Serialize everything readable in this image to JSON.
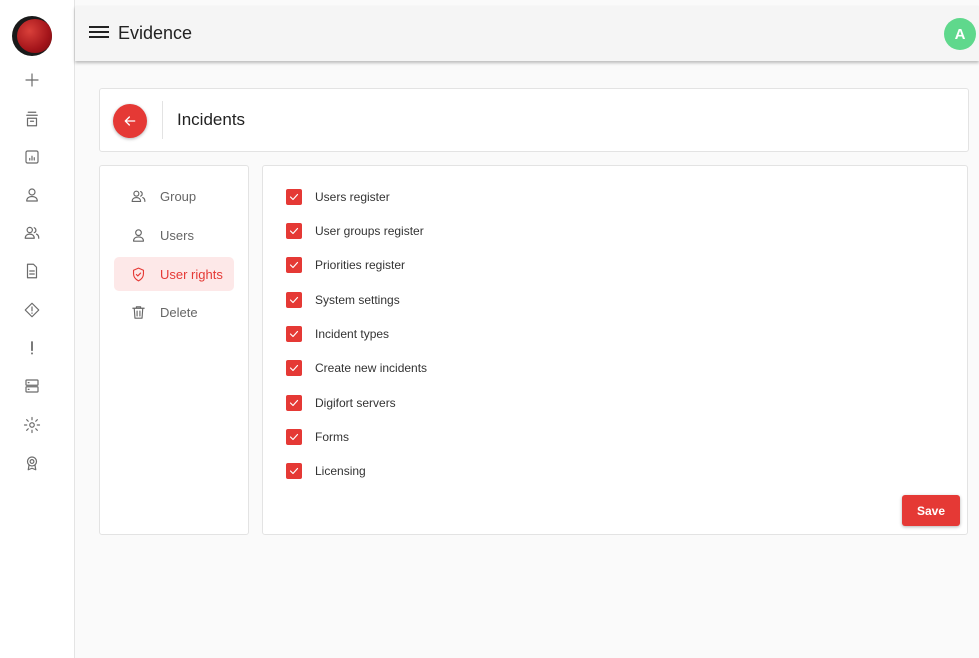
{
  "app": {
    "title": "Evidence",
    "avatar_letter": "A"
  },
  "colors": {
    "accent": "#e53935",
    "avatar": "#5fd88c",
    "active_bg": "#fde8e8"
  },
  "rail": {
    "icons": [
      "plus-icon",
      "archive-icon",
      "report-icon",
      "user-icon",
      "users-icon",
      "document-icon",
      "warning-diamond-icon",
      "exclamation-icon",
      "server-icon",
      "gear-icon",
      "badge-icon"
    ]
  },
  "header": {
    "title": "Incidents"
  },
  "side_menu": {
    "items": [
      {
        "label": "Group",
        "icon": "users-icon",
        "active": false
      },
      {
        "label": "Users",
        "icon": "user-icon",
        "active": false
      },
      {
        "label": "User rights",
        "icon": "shield-check-icon",
        "active": true
      },
      {
        "label": "Delete",
        "icon": "trash-icon",
        "active": false
      }
    ]
  },
  "permissions": [
    {
      "label": "Users register",
      "checked": true
    },
    {
      "label": "User groups register",
      "checked": true
    },
    {
      "label": "Priorities register",
      "checked": true
    },
    {
      "label": "System settings",
      "checked": true
    },
    {
      "label": "Incident types",
      "checked": true
    },
    {
      "label": "Create new incidents",
      "checked": true
    },
    {
      "label": "Digifort servers",
      "checked": true
    },
    {
      "label": "Forms",
      "checked": true
    },
    {
      "label": "Licensing",
      "checked": true
    }
  ],
  "actions": {
    "save_label": "Save"
  }
}
